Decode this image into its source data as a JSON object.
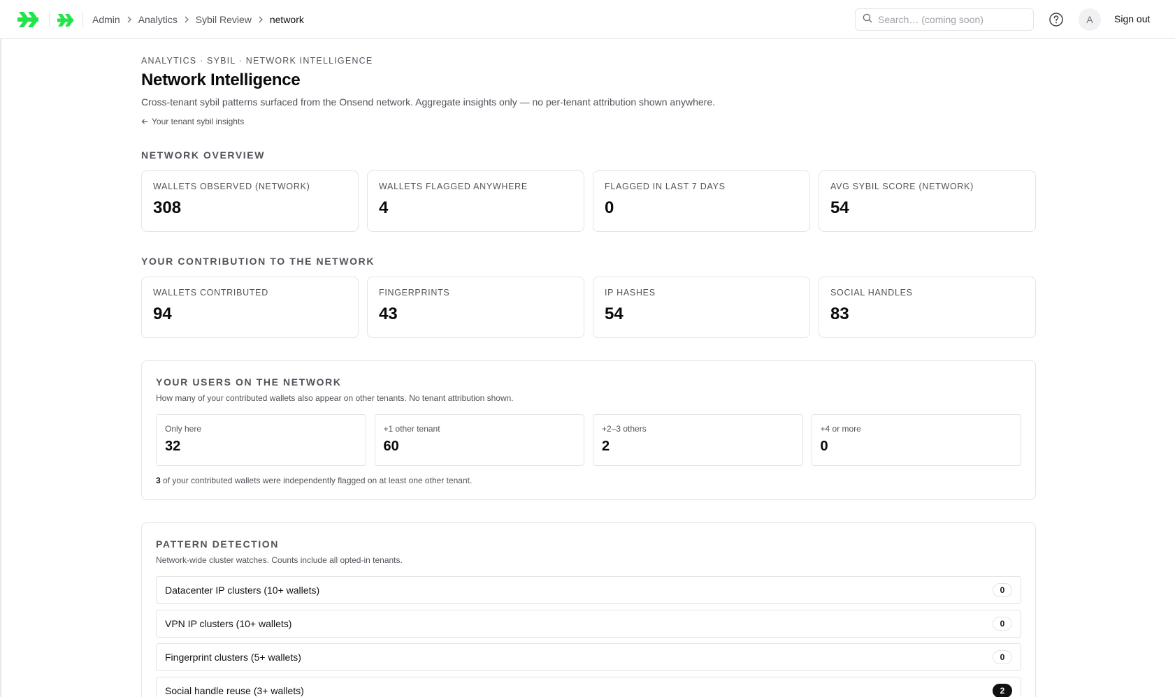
{
  "topbar": {
    "breadcrumb": [
      "Admin",
      "Analytics",
      "Sybil Review",
      "network"
    ],
    "search_placeholder": "Search… (coming soon)",
    "avatar_initial": "A",
    "signout_label": "Sign out",
    "brand_color": "#22e34a"
  },
  "header": {
    "eyebrow": "ANALYTICS · SYBIL · NETWORK INTELLIGENCE",
    "title": "Network Intelligence",
    "subtitle": "Cross-tenant sybil patterns surfaced from the Onsend network. Aggregate insights only — no per-tenant attribution shown anywhere.",
    "back_link": "Your tenant sybil insights"
  },
  "network_overview": {
    "label": "NETWORK OVERVIEW",
    "stats": [
      {
        "label": "WALLETS OBSERVED (NETWORK)",
        "value": "308"
      },
      {
        "label": "WALLETS FLAGGED ANYWHERE",
        "value": "4"
      },
      {
        "label": "FLAGGED IN LAST 7 DAYS",
        "value": "0"
      },
      {
        "label": "AVG SYBIL SCORE (NETWORK)",
        "value": "54"
      }
    ]
  },
  "contribution": {
    "label": "YOUR CONTRIBUTION TO THE NETWORK",
    "stats": [
      {
        "label": "WALLETS CONTRIBUTED",
        "value": "94"
      },
      {
        "label": "FINGERPRINTS",
        "value": "43"
      },
      {
        "label": "IP HASHES",
        "value": "54"
      },
      {
        "label": "SOCIAL HANDLES",
        "value": "83"
      }
    ]
  },
  "users_on_network": {
    "title": "YOUR USERS ON THE NETWORK",
    "subtitle": "How many of your contributed wallets also appear on other tenants. No tenant attribution shown.",
    "buckets": [
      {
        "label": "Only here",
        "value": "32"
      },
      {
        "label": "+1 other tenant",
        "value": "60"
      },
      {
        "label": "+2–3 others",
        "value": "2"
      },
      {
        "label": "+4 or more",
        "value": "0"
      }
    ],
    "flagged_count": "3",
    "flagged_text": " of your contributed wallets were independently flagged on at least one other tenant."
  },
  "pattern_detection": {
    "title": "PATTERN DETECTION",
    "subtitle": "Network-wide cluster watches. Counts include all opted-in tenants.",
    "items": [
      {
        "label": "Datacenter IP clusters (10+ wallets)",
        "count": "0"
      },
      {
        "label": "VPN IP clusters (10+ wallets)",
        "count": "0"
      },
      {
        "label": "Fingerprint clusters (5+ wallets)",
        "count": "0"
      },
      {
        "label": "Social handle reuse (3+ wallets)",
        "count": "2"
      }
    ]
  }
}
